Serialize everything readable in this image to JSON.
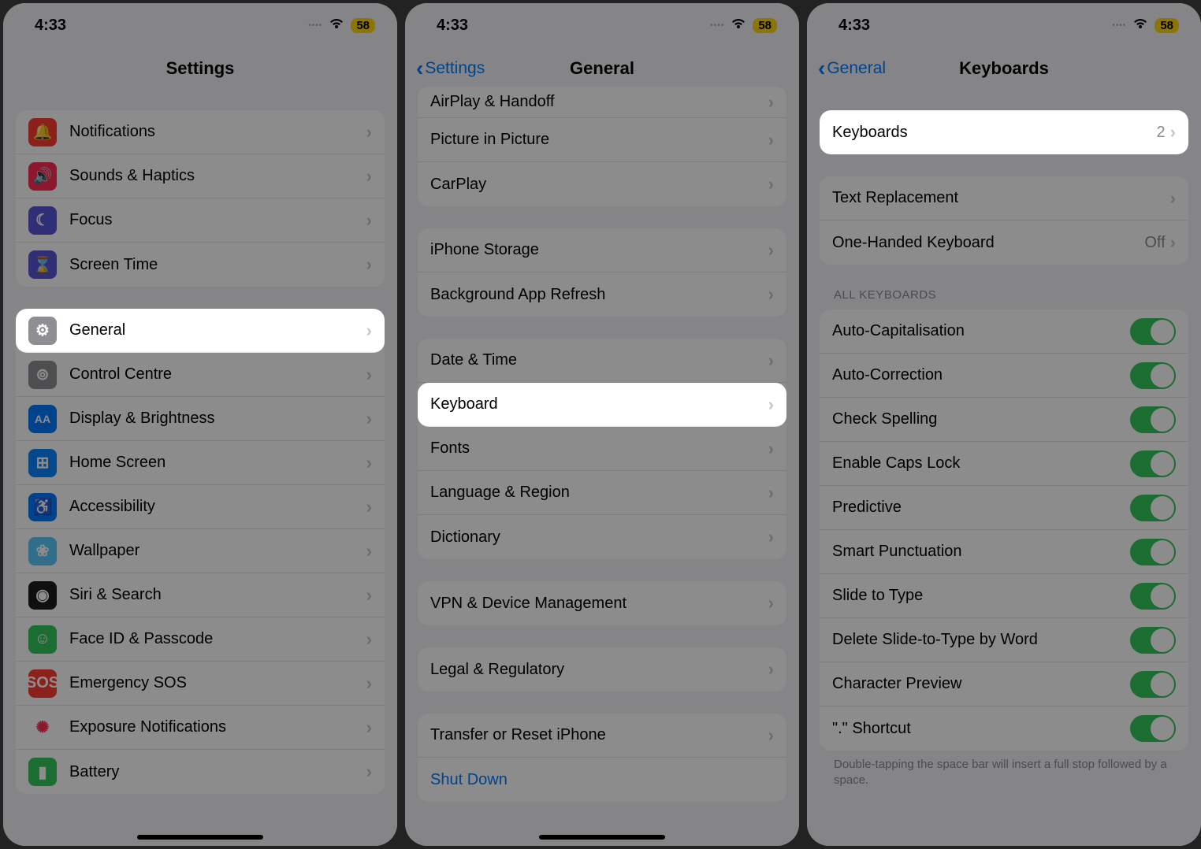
{
  "status": {
    "time": "4:33",
    "battery": "58"
  },
  "screen1": {
    "title": "Settings",
    "rows_a": [
      {
        "label": "Notifications",
        "icon": "bell-icon",
        "bg": "bg-red",
        "glyph": "🔔"
      },
      {
        "label": "Sounds & Haptics",
        "icon": "sound-icon",
        "bg": "bg-pink",
        "glyph": "🔊"
      },
      {
        "label": "Focus",
        "icon": "focus-icon",
        "bg": "bg-purple",
        "glyph": "☾"
      },
      {
        "label": "Screen Time",
        "icon": "screentime-icon",
        "bg": "bg-purple",
        "glyph": "⌛"
      }
    ],
    "rows_b": [
      {
        "label": "General",
        "icon": "gear-icon",
        "bg": "bg-gray",
        "glyph": "⚙",
        "hl": true
      },
      {
        "label": "Control Centre",
        "icon": "control-icon",
        "bg": "bg-gray",
        "glyph": "⊚"
      },
      {
        "label": "Display & Brightness",
        "icon": "display-icon",
        "bg": "bg-blue",
        "glyph": "AA"
      },
      {
        "label": "Home Screen",
        "icon": "home-icon",
        "bg": "bg-dblue",
        "glyph": "⊞"
      },
      {
        "label": "Accessibility",
        "icon": "accessibility-icon",
        "bg": "bg-blue",
        "glyph": "♿"
      },
      {
        "label": "Wallpaper",
        "icon": "wallpaper-icon",
        "bg": "bg-teal",
        "glyph": "❀"
      },
      {
        "label": "Siri & Search",
        "icon": "siri-icon",
        "bg": "bg-black",
        "glyph": "◉"
      },
      {
        "label": "Face ID & Passcode",
        "icon": "faceid-icon",
        "bg": "bg-green",
        "glyph": "☺"
      },
      {
        "label": "Emergency SOS",
        "icon": "sos-icon",
        "bg": "bg-sos",
        "glyph": "SOS"
      },
      {
        "label": "Exposure Notifications",
        "icon": "exposure-icon",
        "bg": "",
        "glyph": "✺"
      },
      {
        "label": "Battery",
        "icon": "battery-icon",
        "bg": "bg-green",
        "glyph": "▮"
      }
    ]
  },
  "screen2": {
    "title": "General",
    "back": "Settings",
    "rows_a": [
      {
        "label": "AirPlay & Handoff"
      },
      {
        "label": "Picture in Picture"
      },
      {
        "label": "CarPlay"
      }
    ],
    "rows_b": [
      {
        "label": "iPhone Storage"
      },
      {
        "label": "Background App Refresh"
      }
    ],
    "rows_c": [
      {
        "label": "Date & Time"
      },
      {
        "label": "Keyboard",
        "hl": true
      },
      {
        "label": "Fonts"
      },
      {
        "label": "Language & Region"
      },
      {
        "label": "Dictionary"
      }
    ],
    "rows_d": [
      {
        "label": "VPN & Device Management"
      }
    ],
    "rows_e": [
      {
        "label": "Legal & Regulatory"
      }
    ],
    "rows_f": [
      {
        "label": "Transfer or Reset iPhone"
      },
      {
        "label": "Shut Down",
        "link": true
      }
    ]
  },
  "screen3": {
    "title": "Keyboards",
    "back": "General",
    "rows_a": [
      {
        "label": "Keyboards",
        "value": "2",
        "hl": true
      }
    ],
    "rows_b": [
      {
        "label": "Text Replacement"
      },
      {
        "label": "One-Handed Keyboard",
        "value": "Off"
      }
    ],
    "section_header": "ALL KEYBOARDS",
    "rows_c": [
      {
        "label": "Auto-Capitalisation",
        "toggle": true
      },
      {
        "label": "Auto-Correction",
        "toggle": true
      },
      {
        "label": "Check Spelling",
        "toggle": true
      },
      {
        "label": "Enable Caps Lock",
        "toggle": true
      },
      {
        "label": "Predictive",
        "toggle": true
      },
      {
        "label": "Smart Punctuation",
        "toggle": true
      },
      {
        "label": "Slide to Type",
        "toggle": true
      },
      {
        "label": "Delete Slide-to-Type by Word",
        "toggle": true
      },
      {
        "label": "Character Preview",
        "toggle": true
      },
      {
        "label": "\".\" Shortcut",
        "toggle": true
      }
    ],
    "footer": "Double-tapping the space bar will insert a full stop followed by a space."
  }
}
